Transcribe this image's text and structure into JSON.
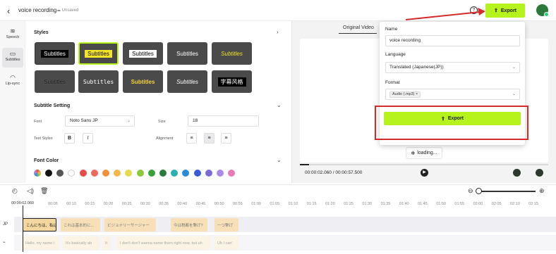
{
  "topbar": {
    "back_icon": "chevron-left-icon",
    "title": "voice recording",
    "unsaved": "Unsaved",
    "help": "?",
    "export_label": "Export"
  },
  "rail": {
    "items": [
      {
        "label": "Speech",
        "icon": "waveform-icon"
      },
      {
        "label": "Subtitles",
        "icon": "subtitles-icon"
      },
      {
        "label": "Lip-sync",
        "icon": "lips-icon"
      }
    ]
  },
  "styles": {
    "title": "Styles",
    "tiles": [
      "Subtitles",
      "Subtitles",
      "Subtitles",
      "Subtitles",
      "Subtitles",
      "Subtitles",
      "Subtitles",
      "Subtitles",
      "Subtitles",
      "字幕风格"
    ]
  },
  "subtitle_setting": {
    "title": "Subtitle Setting",
    "font_label": "Font",
    "font_value": "Noto Sans JP",
    "size_label": "Size",
    "size_value": "18",
    "text_styles_label": "Text Styles",
    "bold": "B",
    "italic": "I",
    "alignment_label": "Alignment"
  },
  "font_color": {
    "title": "Font Color",
    "colors": [
      "#111111",
      "#555555",
      "#ffffff",
      "#e84a4a",
      "#ef6a5a",
      "#f2913a",
      "#f2b84a",
      "#e6d94a",
      "#8ac93a",
      "#3aa03a",
      "#2a7a3a",
      "#2ab0b0",
      "#2a8ad8",
      "#3a5ad8",
      "#7a6ad8",
      "#a88ae8",
      "#e87ab8"
    ]
  },
  "preview": {
    "tab": "Original Video",
    "loading": "loading...",
    "timecode": "00:00:02.060 / 00:00:57.500",
    "progress": 0.036
  },
  "export_panel": {
    "name_label": "Name",
    "name_value": "voice recording",
    "language_label": "Language",
    "language_value": "Translated (Japanese(JP))",
    "format_label": "Format",
    "format_chip": "Audio (.mp3)",
    "export_label": "Export"
  },
  "timeline": {
    "current_time": "00:00:02.060",
    "ticks": [
      "00:05",
      "00:10",
      "00:15",
      "00:20",
      "00:25",
      "00:30",
      "00:35",
      "00:40",
      "00:45",
      "00:50",
      "00:55",
      "01:00",
      "01:05",
      "01:10",
      "01:15",
      "01:20",
      "01:25",
      "01:30",
      "01:35",
      "01:40",
      "01:45",
      "01:50",
      "01:55",
      "02:00",
      "02:05",
      "02:10",
      "02:15"
    ],
    "lane_jp": "JP",
    "jp_clips": [
      "こんにちは、私は",
      "これは基本的に...",
      "ビジョナリーサージャー",
      "今は税都を撃げ?",
      "一つ撃げ"
    ],
    "en_clips": [
      "Hello, my name i",
      "It's basically ab",
      "It",
      "I don't don't wanna name them right now, but uh",
      "Uh I can'"
    ]
  }
}
